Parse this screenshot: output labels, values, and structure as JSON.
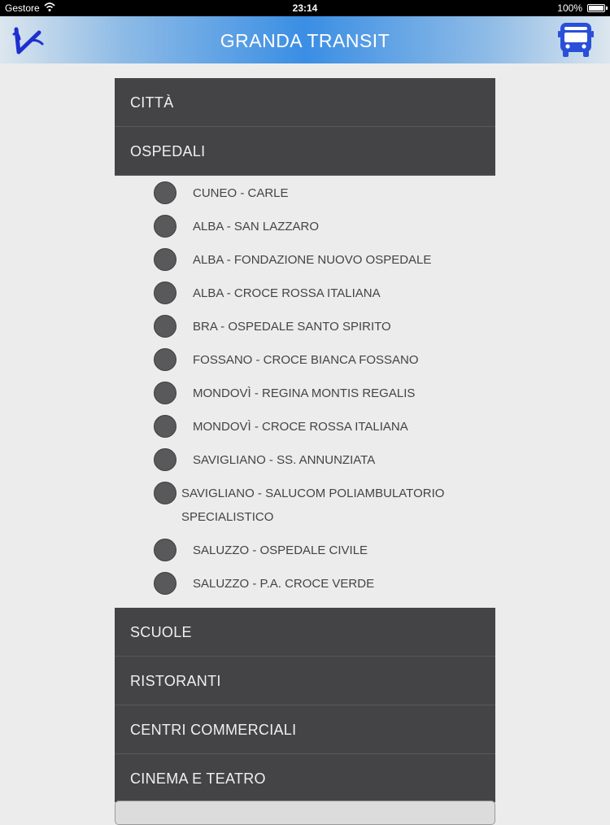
{
  "status_bar": {
    "carrier": "Gestore",
    "time": "23:14",
    "battery": "100%"
  },
  "nav": {
    "title": "GRANDA TRANSIT",
    "logo_icon": "v-logo-icon",
    "bus_icon": "bus-icon"
  },
  "categories": {
    "citta": "CITTÀ",
    "ospedali": "OSPEDALI",
    "scuole": "SCUOLE",
    "ristoranti": "RISTORANTI",
    "centri": "CENTRI COMMERCIALI",
    "cinema": "CINEMA E TEATRO"
  },
  "hospitals": [
    "CUNEO - CARLE",
    "ALBA - SAN LAZZARO",
    "ALBA - FONDAZIONE NUOVO OSPEDALE",
    "ALBA - CROCE ROSSA ITALIANA",
    "BRA - OSPEDALE SANTO SPIRITO",
    "FOSSANO - CROCE BIANCA FOSSANO",
    "MONDOVÌ - REGINA MONTIS REGALIS",
    "MONDOVÌ - CROCE ROSSA ITALIANA",
    "SAVIGLIANO - SS. ANNUNZIATA",
    "SAVIGLIANO - SALUCOM POLIAMBULATORIO SPECIALISTICO",
    "SALUZZO - OSPEDALE CIVILE",
    "SALUZZO - P.A. CROCE VERDE"
  ],
  "colors": {
    "category_bg": "#444345",
    "nav_accent": "#3a8ee4",
    "bus_icon": "#2a4fd8",
    "radio": "#59595b"
  }
}
